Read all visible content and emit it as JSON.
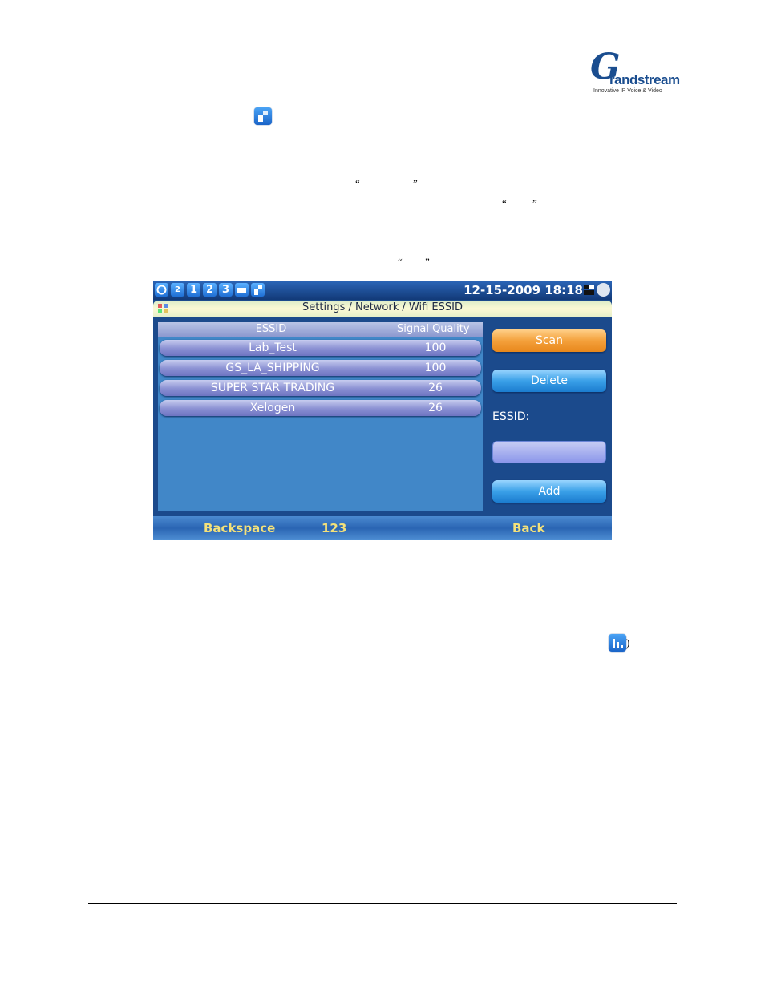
{
  "logo": {
    "script": "G",
    "word": "randstream",
    "tagline": "Innovative IP Voice & Video"
  },
  "document": {
    "quotes": [
      "“",
      "”",
      "“",
      "”",
      "“",
      "”"
    ],
    "trailing_paren": ")"
  },
  "device": {
    "status_icons": [
      "sync-icon",
      "speaker-icon",
      "line-1",
      "line-2",
      "line-3",
      "folder-icon",
      "wifi-icon"
    ],
    "lines": [
      "1",
      "2",
      "3"
    ],
    "speaker_label": "2",
    "datetime": "12-15-2009 18:18",
    "title": "Settings / Network / Wifi ESSID",
    "table": {
      "columns": [
        "ESSID",
        "Signal Quality"
      ],
      "rows": [
        {
          "essid": "Lab_Test",
          "signal": "100"
        },
        {
          "essid": "GS_LA_SHIPPING",
          "signal": "100"
        },
        {
          "essid": "SUPER STAR TRADING",
          "signal": "26"
        },
        {
          "essid": "Xelogen",
          "signal": "26"
        }
      ]
    },
    "buttons": {
      "scan": "Scan",
      "delete": "Delete",
      "add": "Add"
    },
    "essid_label": "ESSID:",
    "essid_input_value": "",
    "softkeys": {
      "left": "Backspace",
      "middle": "123",
      "right": "Back"
    },
    "colors": {
      "accent_orange": "#f4a13c",
      "screen_bg": "#1b4a8c",
      "softkey": "#f4e17a"
    }
  }
}
